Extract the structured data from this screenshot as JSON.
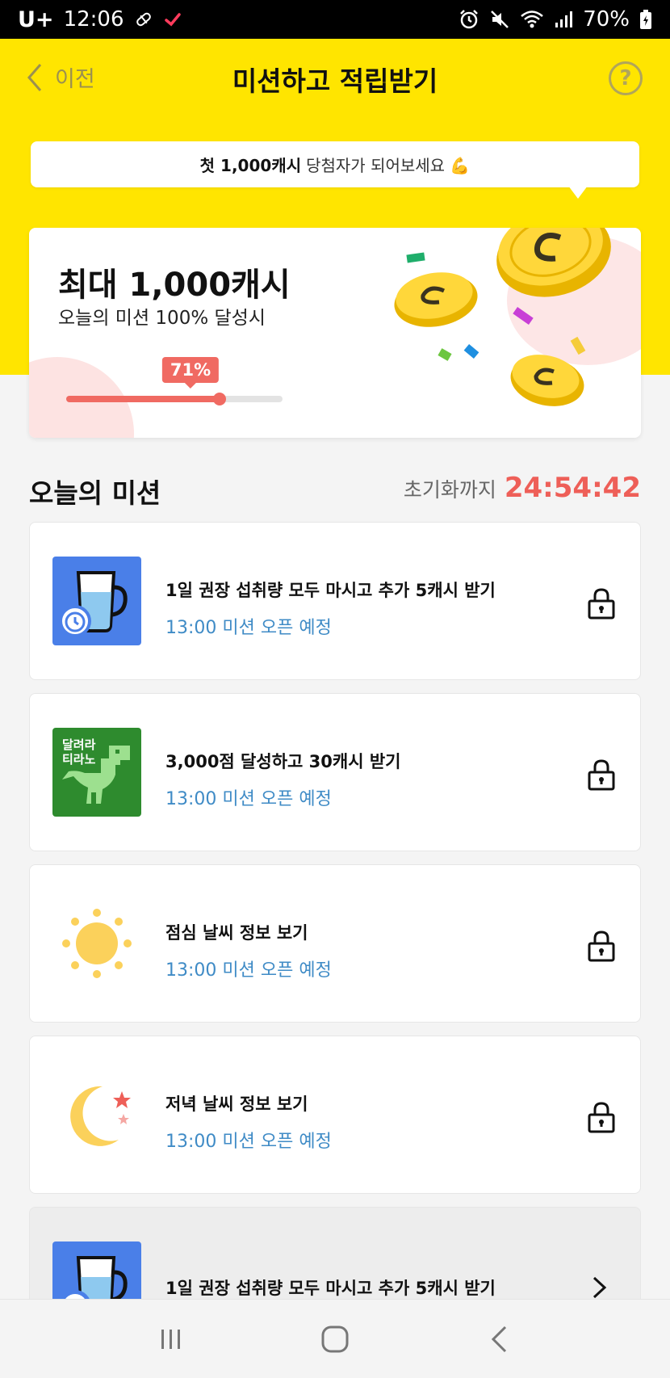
{
  "status_bar": {
    "carrier": "U+",
    "time": "12:06",
    "battery": "70%",
    "icons": [
      "pill-icon",
      "check-icon",
      "alarm-icon",
      "mute-icon",
      "wifi-icon",
      "signal-icon",
      "battery-charging-icon"
    ]
  },
  "header": {
    "back_label": "이전",
    "title": "미션하고 적립받기",
    "help_icon": "question-circle-icon"
  },
  "bubble": {
    "strong": "첫 1,000캐시",
    "text": "당첨자가 되어보세요 💪"
  },
  "promo": {
    "title": "최대 1,000캐시",
    "subtitle": "오늘의 미션 100% 달성시",
    "progress_label": "71%",
    "progress": 0.71
  },
  "section": {
    "title": "오늘의 미션",
    "reset_label": "초기화까지",
    "reset_timer": "24:54:42"
  },
  "missions": [
    {
      "title": "1일 권장 섭취량 모두 마시고 추가 5캐시 받기",
      "status": "13:00 미션 오픈 예정",
      "icon": "water-cup-alarm-icon",
      "action": "lock-icon"
    },
    {
      "title": "3,000점 달성하고 30캐시 받기",
      "status": "13:00 미션 오픈 예정",
      "icon": "dino-game-icon",
      "icon_text_1": "달려라",
      "icon_text_2": "티라노",
      "action": "lock-icon"
    },
    {
      "title": "점심 날씨 정보 보기",
      "status": "13:00 미션 오픈 예정",
      "icon": "sun-icon",
      "action": "lock-icon"
    },
    {
      "title": "저녁 날씨 정보 보기",
      "status": "13:00 미션 오픈 예정",
      "icon": "moon-stars-icon",
      "action": "lock-icon"
    },
    {
      "title": "1일 권장 섭취량 모두 마시고 추가 5캐시 받기",
      "status": "",
      "icon": "water-cup-alarm-icon",
      "action": "chevron-right-icon"
    }
  ],
  "colors": {
    "header_yellow": "#ffe500",
    "accent_red": "#ee5f58",
    "status_blue": "#3f8bc6"
  },
  "nav": [
    "recent-apps-icon",
    "home-icon",
    "back-icon"
  ]
}
